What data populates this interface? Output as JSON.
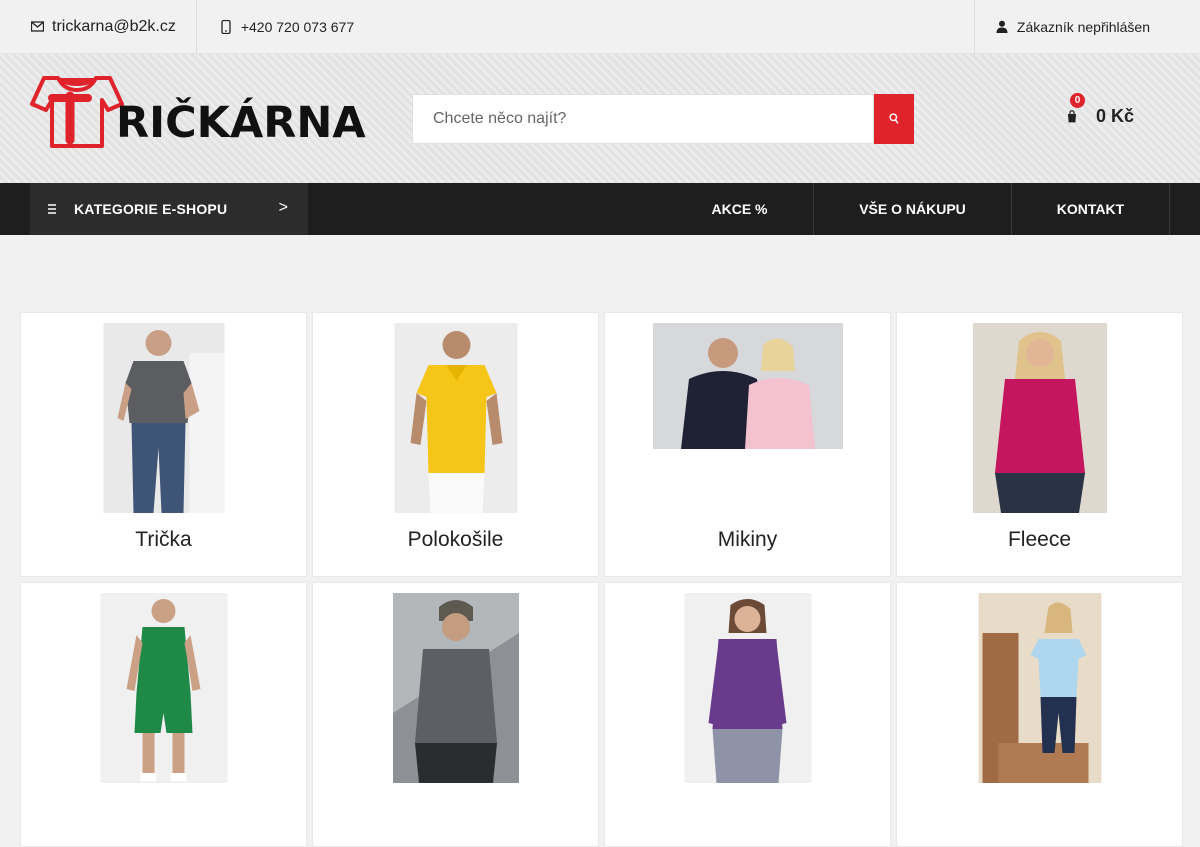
{
  "topbar": {
    "email": "trickarna@b2k.cz",
    "phone": "+420 720 073 677",
    "login_status": "Zákazník nepřihlášen"
  },
  "header": {
    "logo_text": "RIČKÁRNA",
    "search_placeholder": "Chcete něco najít?",
    "cart_count": "0",
    "cart_total": "0 Kč"
  },
  "nav": {
    "categories_label": "KATEGORIE E-SHOPU",
    "categories_chevron": ">",
    "links": [
      "AKCE %",
      "VŠE O NÁKUPU",
      "KONTAKT"
    ]
  },
  "categories": [
    {
      "title": "Trička",
      "image": "man-grey-tshirt"
    },
    {
      "title": "Polokošile",
      "image": "man-yellow-polo"
    },
    {
      "title": "Mikiny",
      "image": "couple-hoodies"
    },
    {
      "title": "Fleece",
      "image": "woman-pink-fleece"
    },
    {
      "title": "",
      "image": "man-green-basketball-jersey"
    },
    {
      "title": "",
      "image": "man-grey-softshell-jacket"
    },
    {
      "title": "",
      "image": "woman-purple-shirt"
    },
    {
      "title": "",
      "image": "girl-light-blue-tshirt"
    }
  ],
  "colors": {
    "accent": "#e0222b",
    "nav_bg": "#1e1e1e",
    "nav_cat_bg": "#2c2c2c"
  }
}
